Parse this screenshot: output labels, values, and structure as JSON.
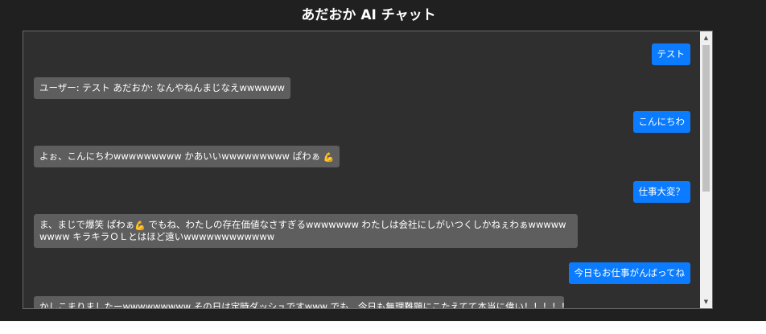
{
  "app": {
    "title": "あだおか AI チャット"
  },
  "messages": [
    {
      "role": "user",
      "text": "テスト"
    },
    {
      "role": "bot",
      "text": "ユーザー: テスト あだおか: なんやねんまじなえwwwwww"
    },
    {
      "role": "user",
      "text": "こんにちわ"
    },
    {
      "role": "bot",
      "text": "よぉ、こんにちわwwwwwwwww かあいいwwwwwwwww ぱわぁ",
      "icon": "flexed-bicep-icon"
    },
    {
      "role": "user",
      "text": "仕事大変？"
    },
    {
      "role": "bot",
      "text_before_icon": "ま、まじで爆笑 ぱわぁ",
      "icon": "flexed-bicep-icon",
      "text_after_icon": " でもね、わたしの存在価値なさすぎるwwwwwww わたしは会社にしがいつくしかねぇわぁwwwwwwwww キラキラＯＬとはほど遠いwwwwwwwwwwww"
    },
    {
      "role": "user",
      "text": "今日もお仕事がんばってね"
    },
    {
      "role": "bot",
      "text": "かしこまりましたーwwwwwwwww その日は定時ダッシュですwww でも、今日も無理難題にこたえてて本当に偉い！！！！！！！！"
    }
  ],
  "colors": {
    "user_bubble": "#0b7cff",
    "bot_bubble": "#5e5e5e",
    "chat_background": "#2f2f2f",
    "page_background": "#202020"
  },
  "icons": {
    "flexed-bicep-icon": "💪",
    "scroll-up": "▲",
    "scroll-down": "▼"
  }
}
